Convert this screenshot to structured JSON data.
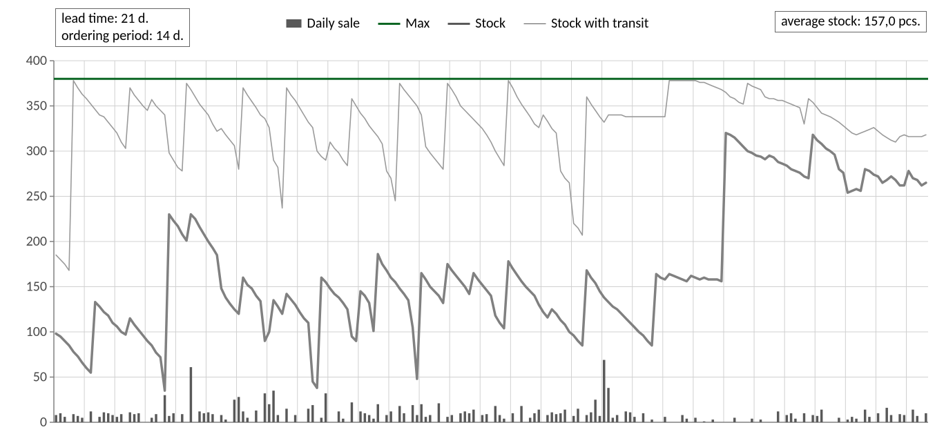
{
  "info_left_line1": "lead time: 21 d.",
  "info_left_line2": "ordering period: 14 d.",
  "info_right": "average stock: 157,0 pcs.",
  "legend": {
    "daily_sale": "Daily sale",
    "max": "Max",
    "stock": "Stock",
    "stock_with_transit": "Stock with transit"
  },
  "colors": {
    "bar": "#595959",
    "max": "#0b6623",
    "stock": "#808080",
    "transit": "#9a9a9a",
    "grid": "#d0d0d0",
    "axis": "#808080",
    "text": "#4a4a4a"
  },
  "chart_data": {
    "type": "combo",
    "ylim": [
      0,
      400
    ],
    "yticks": [
      0,
      50,
      100,
      150,
      200,
      250,
      300,
      350,
      400
    ],
    "max_line": 380,
    "series": [
      {
        "name": "Daily sale",
        "type": "bar",
        "values": [
          8,
          10,
          6,
          0,
          9,
          7,
          5,
          0,
          12,
          0,
          6,
          11,
          10,
          8,
          6,
          9,
          0,
          11,
          9,
          10,
          0,
          0,
          5,
          9,
          0,
          30,
          7,
          10,
          0,
          9,
          0,
          61,
          0,
          12,
          10,
          11,
          9,
          0,
          8,
          3,
          0,
          25,
          28,
          12,
          5,
          0,
          13,
          0,
          32,
          20,
          35,
          8,
          0,
          15,
          0,
          8,
          0,
          0,
          15,
          19,
          0,
          5,
          32,
          0,
          0,
          12,
          4,
          0,
          22,
          0,
          12,
          10,
          8,
          4,
          20,
          0,
          8,
          12,
          0,
          18,
          10,
          0,
          19,
          8,
          20,
          6,
          8,
          0,
          21,
          0,
          6,
          8,
          0,
          10,
          12,
          10,
          14,
          0,
          8,
          9,
          0,
          18,
          8,
          4,
          0,
          10,
          0,
          18,
          0,
          5,
          10,
          14,
          0,
          8,
          11,
          9,
          10,
          14,
          0,
          7,
          15,
          0,
          8,
          11,
          25,
          7,
          69,
          38,
          5,
          8,
          0,
          12,
          11,
          6,
          0,
          10,
          0,
          3,
          0,
          0,
          6,
          0,
          0,
          0,
          8,
          4,
          0,
          5,
          0,
          1,
          0,
          3,
          0,
          0,
          0,
          0,
          5,
          0,
          0,
          0,
          4,
          0,
          3,
          0,
          0,
          0,
          12,
          0,
          8,
          10,
          4,
          0,
          10,
          0,
          8,
          7,
          14,
          0,
          0,
          0,
          5,
          0,
          3,
          6,
          4,
          0,
          14,
          6,
          0,
          10,
          0,
          16,
          8,
          0,
          9,
          8,
          0,
          14,
          7,
          0,
          10
        ]
      },
      {
        "name": "Max",
        "type": "line_constant",
        "value": 380
      },
      {
        "name": "Stock",
        "type": "line",
        "values": [
          98,
          95,
          90,
          85,
          78,
          73,
          66,
          60,
          55,
          133,
          128,
          122,
          118,
          110,
          106,
          100,
          97,
          115,
          108,
          102,
          96,
          90,
          85,
          77,
          72,
          35,
          230,
          223,
          217,
          208,
          201,
          230,
          225,
          216,
          208,
          200,
          193,
          185,
          148,
          138,
          131,
          125,
          120,
          160,
          152,
          148,
          140,
          134,
          90,
          100,
          135,
          128,
          120,
          142,
          136,
          130,
          122,
          115,
          110,
          45,
          38,
          160,
          155,
          148,
          142,
          138,
          132,
          125,
          95,
          90,
          145,
          140,
          132,
          101,
          186,
          175,
          168,
          160,
          155,
          148,
          142,
          135,
          105,
          48,
          165,
          158,
          150,
          145,
          140,
          132,
          175,
          168,
          162,
          156,
          150,
          142,
          165,
          158,
          152,
          146,
          140,
          118,
          110,
          104,
          178,
          170,
          163,
          156,
          150,
          145,
          140,
          130,
          122,
          116,
          125,
          120,
          113,
          108,
          100,
          96,
          90,
          85,
          168,
          160,
          154,
          145,
          138,
          133,
          128,
          125,
          120,
          115,
          110,
          105,
          100,
          96,
          90,
          85,
          164,
          160,
          158,
          164,
          162,
          160,
          158,
          156,
          162,
          160,
          158,
          160,
          158,
          158,
          158,
          156,
          320,
          318,
          315,
          310,
          305,
          300,
          298,
          295,
          294,
          291,
          295,
          293,
          288,
          286,
          284,
          280,
          278,
          276,
          272,
          270,
          318,
          312,
          308,
          303,
          300,
          296,
          280,
          276,
          254,
          256,
          258,
          256,
          280,
          278,
          274,
          272,
          265,
          268,
          272,
          268,
          262,
          262,
          278,
          270,
          268,
          262,
          265
        ]
      },
      {
        "name": "Stock with transit",
        "type": "line",
        "values": [
          185,
          180,
          175,
          168,
          378,
          370,
          363,
          358,
          352,
          346,
          340,
          338,
          332,
          326,
          320,
          310,
          303,
          370,
          362,
          356,
          350,
          345,
          357,
          350,
          345,
          340,
          298,
          290,
          282,
          278,
          375,
          368,
          360,
          352,
          346,
          340,
          330,
          322,
          325,
          318,
          312,
          306,
          280,
          370,
          362,
          355,
          348,
          340,
          336,
          326,
          290,
          282,
          237,
          370,
          362,
          356,
          348,
          340,
          332,
          326,
          300,
          294,
          290,
          310,
          303,
          298,
          290,
          284,
          358,
          350,
          342,
          336,
          328,
          322,
          316,
          308,
          278,
          270,
          245,
          375,
          368,
          362,
          356,
          350,
          340,
          305,
          298,
          292,
          286,
          280,
          375,
          368,
          360,
          350,
          345,
          340,
          335,
          330,
          325,
          318,
          310,
          300,
          292,
          284,
          378,
          370,
          360,
          352,
          345,
          338,
          330,
          326,
          340,
          333,
          325,
          320,
          278,
          270,
          265,
          220,
          215,
          207,
          360,
          352,
          345,
          338,
          332,
          340,
          340,
          340,
          340,
          338,
          338,
          338,
          338,
          338,
          338,
          338,
          338,
          338,
          338,
          378,
          378,
          378,
          378,
          378,
          378,
          378,
          376,
          376,
          374,
          372,
          370,
          368,
          365,
          360,
          358,
          354,
          352,
          375,
          372,
          370,
          368,
          360,
          358,
          358,
          356,
          356,
          354,
          352,
          350,
          348,
          330,
          358,
          354,
          348,
          342,
          340,
          338,
          335,
          332,
          328,
          324,
          320,
          318,
          320,
          322,
          324,
          326,
          322,
          318,
          315,
          312,
          310,
          316,
          318,
          316,
          316,
          316,
          316,
          318
        ]
      }
    ]
  }
}
